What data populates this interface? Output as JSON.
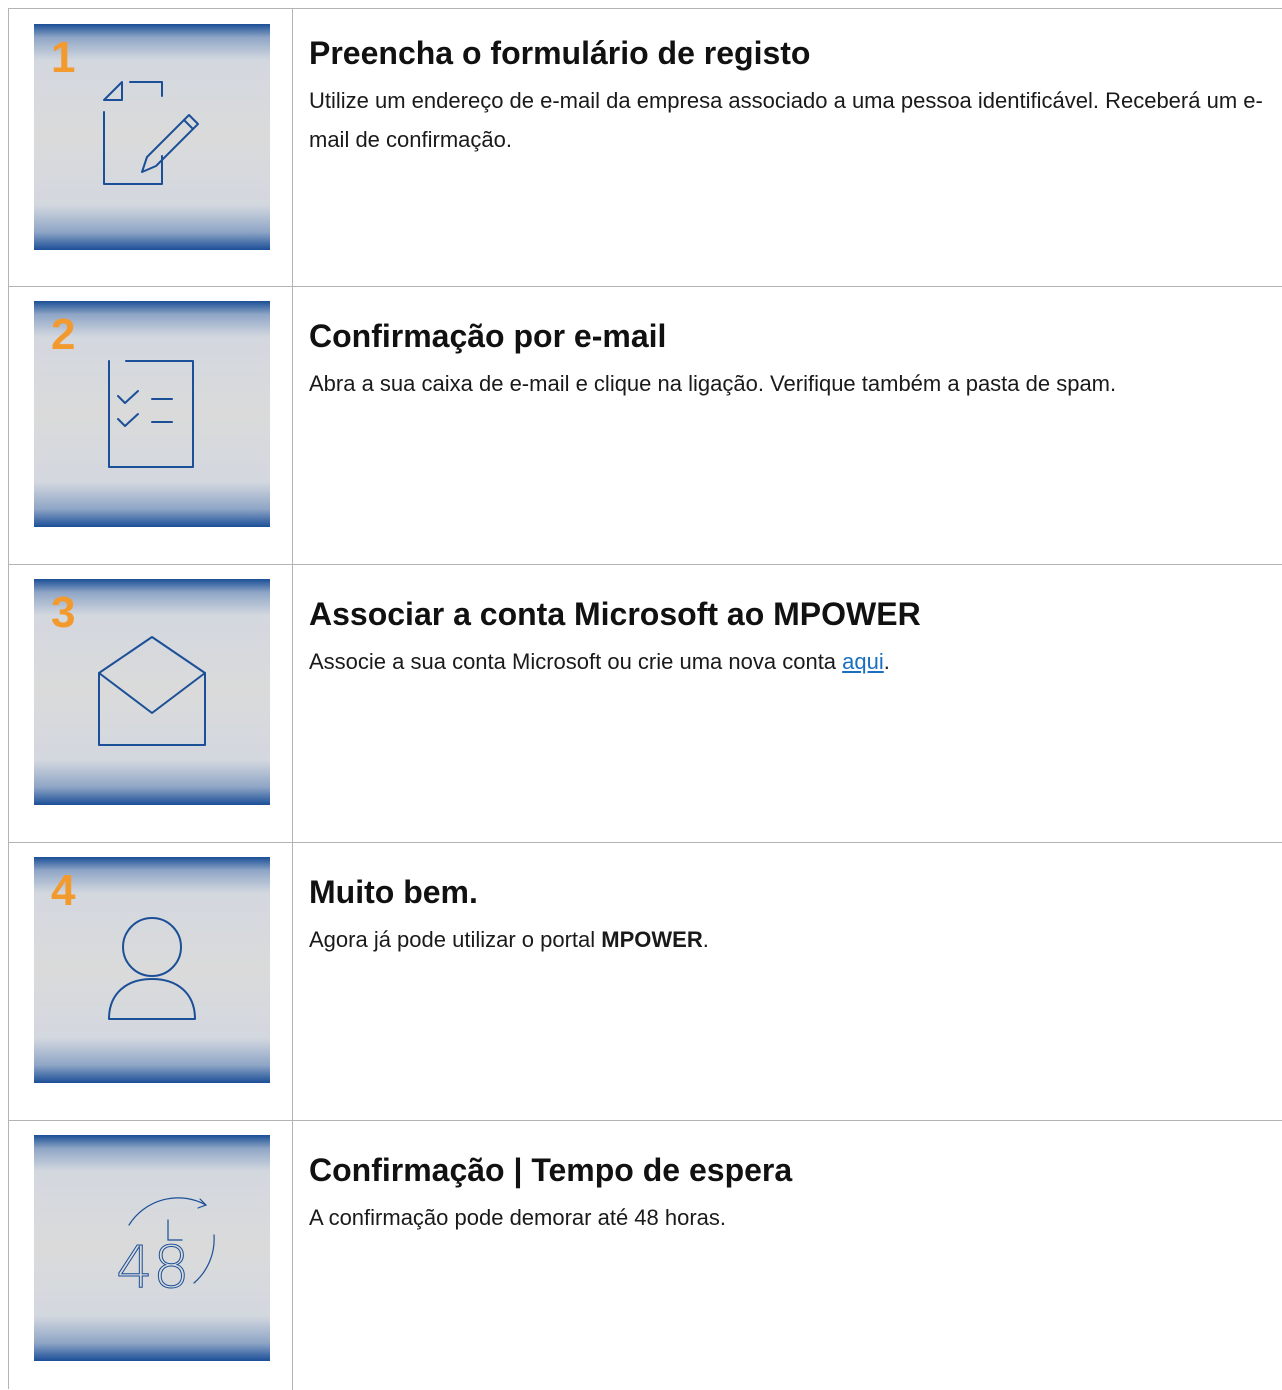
{
  "steps": [
    {
      "number": "1",
      "icon": "form-edit-icon",
      "title": "Preencha o formulário de registo",
      "description": "Utilize um endereço de e-mail da empresa associado a uma pessoa identificável. Receberá um e-mail de confirmação."
    },
    {
      "number": "2",
      "icon": "checklist-icon",
      "title": "Confirmação por e-mail",
      "description": "Abra a sua caixa de e-mail e clique na ligação. Verifique também a pasta de spam."
    },
    {
      "number": "3",
      "icon": "envelope-icon",
      "title": "Associar a conta Microsoft ao MPOWER",
      "description_before": "Associe a sua conta Microsoft ou crie uma nova conta ",
      "link_text": "aqui",
      "description_after": "."
    },
    {
      "number": "4",
      "icon": "user-icon",
      "title": "Muito bem.",
      "description_before": "Agora já pode utilizar o portal ",
      "description_bold": "MPOWER",
      "description_after": "."
    },
    {
      "number": "",
      "icon": "48-hours-clock-icon",
      "icon_text": "48",
      "title": "Confirmação | Tempo de espera",
      "description": "A confirmação pode demorar até 48 horas."
    }
  ],
  "colors": {
    "step_number": "#f39a2e",
    "tile_band": "#1b4f97",
    "icon_stroke": "#1b4f97",
    "link": "#1a6fc1"
  }
}
